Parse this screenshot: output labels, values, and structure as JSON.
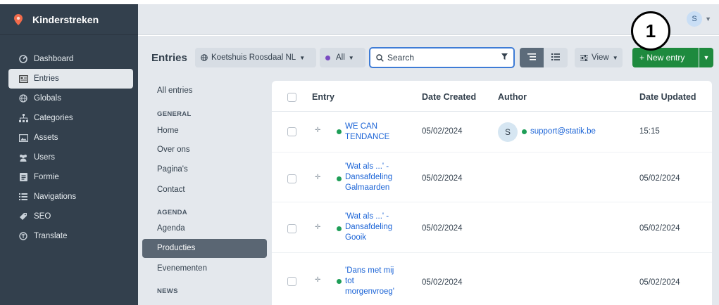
{
  "app": {
    "name": "Kinderstreken",
    "user_initial": "S"
  },
  "annotation": {
    "label": "1"
  },
  "sidebar": {
    "items": [
      {
        "label": "Dashboard",
        "icon": "dashboard-icon"
      },
      {
        "label": "Entries",
        "icon": "entries-icon",
        "active": true
      },
      {
        "label": "Globals",
        "icon": "globe-icon"
      },
      {
        "label": "Categories",
        "icon": "sitemap-icon"
      },
      {
        "label": "Assets",
        "icon": "image-icon"
      },
      {
        "label": "Users",
        "icon": "users-icon"
      },
      {
        "label": "Formie",
        "icon": "form-icon"
      },
      {
        "label": "Navigations",
        "icon": "list-icon"
      },
      {
        "label": "SEO",
        "icon": "seo-icon"
      },
      {
        "label": "Translate",
        "icon": "translate-icon"
      }
    ]
  },
  "toolbar": {
    "title": "Entries",
    "site": "Koetshuis Roosdaal NL",
    "status": "All",
    "search_placeholder": "Search",
    "view_label": "View",
    "new_entry_label": "+ New entry"
  },
  "sources": {
    "all_entries": "All entries",
    "general_heading": "GENERAL",
    "general": [
      "Home",
      "Over ons",
      "Pagina's",
      "Contact"
    ],
    "agenda_heading": "AGENDA",
    "agenda": [
      "Agenda",
      "Producties",
      "Evenementen"
    ],
    "news_heading": "NEWS"
  },
  "table": {
    "columns": [
      "Entry",
      "Date Created",
      "Author",
      "Date Updated"
    ],
    "rows": [
      {
        "title_lines": [
          "WE CAN",
          "TENDANCE"
        ],
        "date_created": "05/02/2024",
        "author_initial": "S",
        "author": "support@statik.be",
        "date_updated": "15:15"
      },
      {
        "title_lines": [
          "'Wat als ...' -",
          "Dansafdeling",
          "Galmaarden"
        ],
        "date_created": "05/02/2024",
        "author_initial": "",
        "author": "",
        "date_updated": "05/02/2024"
      },
      {
        "title_lines": [
          "'Wat als ...' -",
          "Dansafdeling",
          "Gooik"
        ],
        "date_created": "05/02/2024",
        "author_initial": "",
        "author": "",
        "date_updated": "05/02/2024"
      },
      {
        "title_lines": [
          "'Dans met mij",
          "tot",
          "morgenvroeg'"
        ],
        "date_created": "05/02/2024",
        "author_initial": "",
        "author": "",
        "date_updated": "05/02/2024"
      }
    ]
  },
  "colors": {
    "sidebar": "#33404d",
    "accent": "#1a63d6",
    "new_button": "#1e8a3e",
    "status_enabled": "#1e9e57"
  }
}
